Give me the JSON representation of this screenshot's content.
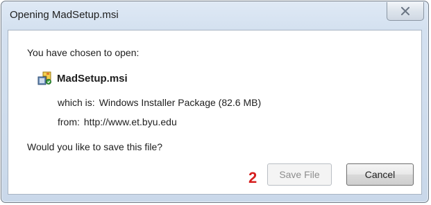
{
  "window": {
    "title": "Opening MadSetup.msi",
    "close_icon": "close-icon"
  },
  "dialog": {
    "prompt": "You have chosen to open:",
    "file_name": "MadSetup.msi",
    "file_icon": "installer-package-icon",
    "which_is_label": "which is:",
    "which_is_value": "Windows Installer Package (82.6 MB)",
    "from_label": "from:",
    "from_value": "http://www.et.byu.edu",
    "question": "Would you like to save this file?"
  },
  "annotation": {
    "step_number": "2",
    "color": "#d61f1f"
  },
  "buttons": {
    "save_label": "Save File",
    "save_state": "disabled",
    "cancel_label": "Cancel"
  }
}
